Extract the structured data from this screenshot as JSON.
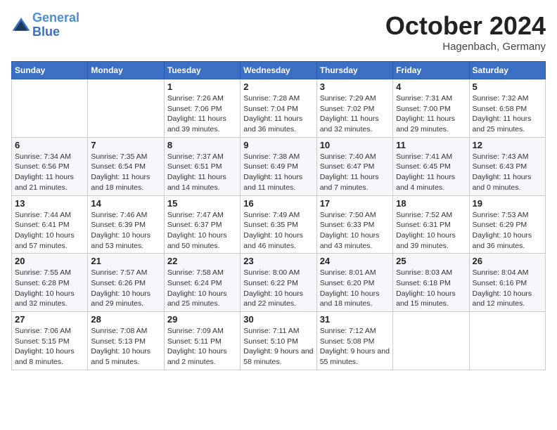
{
  "header": {
    "logo_line1": "General",
    "logo_line2": "Blue",
    "month": "October 2024",
    "location": "Hagenbach, Germany"
  },
  "days_of_week": [
    "Sunday",
    "Monday",
    "Tuesday",
    "Wednesday",
    "Thursday",
    "Friday",
    "Saturday"
  ],
  "weeks": [
    [
      {
        "day": "",
        "info": ""
      },
      {
        "day": "",
        "info": ""
      },
      {
        "day": "1",
        "info": "Sunrise: 7:26 AM\nSunset: 7:06 PM\nDaylight: 11 hours and 39 minutes."
      },
      {
        "day": "2",
        "info": "Sunrise: 7:28 AM\nSunset: 7:04 PM\nDaylight: 11 hours and 36 minutes."
      },
      {
        "day": "3",
        "info": "Sunrise: 7:29 AM\nSunset: 7:02 PM\nDaylight: 11 hours and 32 minutes."
      },
      {
        "day": "4",
        "info": "Sunrise: 7:31 AM\nSunset: 7:00 PM\nDaylight: 11 hours and 29 minutes."
      },
      {
        "day": "5",
        "info": "Sunrise: 7:32 AM\nSunset: 6:58 PM\nDaylight: 11 hours and 25 minutes."
      }
    ],
    [
      {
        "day": "6",
        "info": "Sunrise: 7:34 AM\nSunset: 6:56 PM\nDaylight: 11 hours and 21 minutes."
      },
      {
        "day": "7",
        "info": "Sunrise: 7:35 AM\nSunset: 6:54 PM\nDaylight: 11 hours and 18 minutes."
      },
      {
        "day": "8",
        "info": "Sunrise: 7:37 AM\nSunset: 6:51 PM\nDaylight: 11 hours and 14 minutes."
      },
      {
        "day": "9",
        "info": "Sunrise: 7:38 AM\nSunset: 6:49 PM\nDaylight: 11 hours and 11 minutes."
      },
      {
        "day": "10",
        "info": "Sunrise: 7:40 AM\nSunset: 6:47 PM\nDaylight: 11 hours and 7 minutes."
      },
      {
        "day": "11",
        "info": "Sunrise: 7:41 AM\nSunset: 6:45 PM\nDaylight: 11 hours and 4 minutes."
      },
      {
        "day": "12",
        "info": "Sunrise: 7:43 AM\nSunset: 6:43 PM\nDaylight: 11 hours and 0 minutes."
      }
    ],
    [
      {
        "day": "13",
        "info": "Sunrise: 7:44 AM\nSunset: 6:41 PM\nDaylight: 10 hours and 57 minutes."
      },
      {
        "day": "14",
        "info": "Sunrise: 7:46 AM\nSunset: 6:39 PM\nDaylight: 10 hours and 53 minutes."
      },
      {
        "day": "15",
        "info": "Sunrise: 7:47 AM\nSunset: 6:37 PM\nDaylight: 10 hours and 50 minutes."
      },
      {
        "day": "16",
        "info": "Sunrise: 7:49 AM\nSunset: 6:35 PM\nDaylight: 10 hours and 46 minutes."
      },
      {
        "day": "17",
        "info": "Sunrise: 7:50 AM\nSunset: 6:33 PM\nDaylight: 10 hours and 43 minutes."
      },
      {
        "day": "18",
        "info": "Sunrise: 7:52 AM\nSunset: 6:31 PM\nDaylight: 10 hours and 39 minutes."
      },
      {
        "day": "19",
        "info": "Sunrise: 7:53 AM\nSunset: 6:29 PM\nDaylight: 10 hours and 36 minutes."
      }
    ],
    [
      {
        "day": "20",
        "info": "Sunrise: 7:55 AM\nSunset: 6:28 PM\nDaylight: 10 hours and 32 minutes."
      },
      {
        "day": "21",
        "info": "Sunrise: 7:57 AM\nSunset: 6:26 PM\nDaylight: 10 hours and 29 minutes."
      },
      {
        "day": "22",
        "info": "Sunrise: 7:58 AM\nSunset: 6:24 PM\nDaylight: 10 hours and 25 minutes."
      },
      {
        "day": "23",
        "info": "Sunrise: 8:00 AM\nSunset: 6:22 PM\nDaylight: 10 hours and 22 minutes."
      },
      {
        "day": "24",
        "info": "Sunrise: 8:01 AM\nSunset: 6:20 PM\nDaylight: 10 hours and 18 minutes."
      },
      {
        "day": "25",
        "info": "Sunrise: 8:03 AM\nSunset: 6:18 PM\nDaylight: 10 hours and 15 minutes."
      },
      {
        "day": "26",
        "info": "Sunrise: 8:04 AM\nSunset: 6:16 PM\nDaylight: 10 hours and 12 minutes."
      }
    ],
    [
      {
        "day": "27",
        "info": "Sunrise: 7:06 AM\nSunset: 5:15 PM\nDaylight: 10 hours and 8 minutes."
      },
      {
        "day": "28",
        "info": "Sunrise: 7:08 AM\nSunset: 5:13 PM\nDaylight: 10 hours and 5 minutes."
      },
      {
        "day": "29",
        "info": "Sunrise: 7:09 AM\nSunset: 5:11 PM\nDaylight: 10 hours and 2 minutes."
      },
      {
        "day": "30",
        "info": "Sunrise: 7:11 AM\nSunset: 5:10 PM\nDaylight: 9 hours and 58 minutes."
      },
      {
        "day": "31",
        "info": "Sunrise: 7:12 AM\nSunset: 5:08 PM\nDaylight: 9 hours and 55 minutes."
      },
      {
        "day": "",
        "info": ""
      },
      {
        "day": "",
        "info": ""
      }
    ]
  ]
}
